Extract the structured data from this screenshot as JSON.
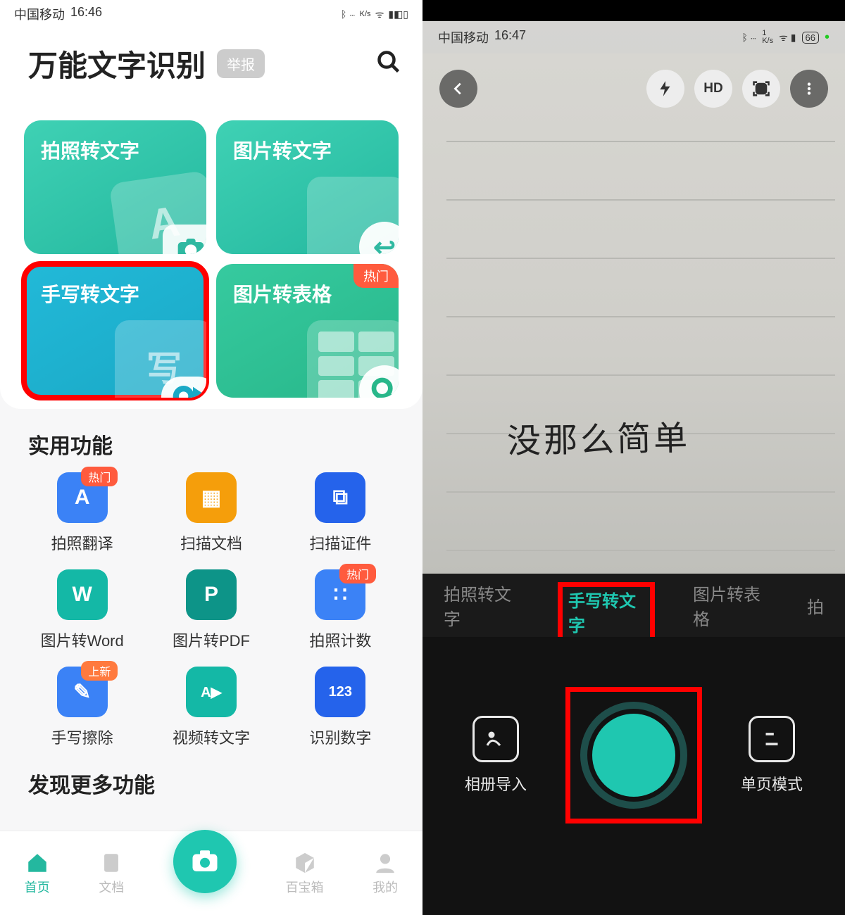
{
  "left": {
    "status": {
      "carrier": "中国移动",
      "time": "16:46",
      "net_speed": "K/s"
    },
    "header": {
      "title": "万能文字识别",
      "report_badge": "举报"
    },
    "cards": [
      {
        "label": "拍照转文字"
      },
      {
        "label": "图片转文字"
      },
      {
        "label": "手写转文字"
      },
      {
        "label": "图片转表格",
        "badge": "热门"
      }
    ],
    "section_practical": "实用功能",
    "funcs": [
      {
        "label": "拍照翻译",
        "badge": "热门",
        "glyph": "A"
      },
      {
        "label": "扫描文档",
        "glyph": "▦"
      },
      {
        "label": "扫描证件",
        "glyph": "⧉"
      },
      {
        "label": "图片转Word",
        "glyph": "W"
      },
      {
        "label": "图片转PDF",
        "glyph": "P"
      },
      {
        "label": "拍照计数",
        "badge": "热门",
        "glyph": "∷"
      },
      {
        "label": "手写擦除",
        "badge": "上新",
        "glyph": "✎"
      },
      {
        "label": "视频转文字",
        "glyph": "A▶"
      },
      {
        "label": "识别数字",
        "glyph": "123"
      }
    ],
    "section_discover": "发现更多功能",
    "nav": [
      {
        "label": "首页"
      },
      {
        "label": "文档"
      },
      {
        "label": "百宝箱"
      },
      {
        "label": "我的"
      }
    ]
  },
  "right": {
    "status": {
      "carrier": "中国移动",
      "time": "16:47",
      "net_speed": "K/s",
      "battery": "66"
    },
    "top_icons": {
      "hd": "HD"
    },
    "handwriting_text": "没那么简单",
    "modes": [
      {
        "label": "拍照转文字"
      },
      {
        "label": "手写转文字",
        "active": true
      },
      {
        "label": "图片转表格"
      },
      {
        "label": "拍"
      }
    ],
    "controls": {
      "gallery": "相册导入",
      "page_mode": "单页模式"
    }
  }
}
